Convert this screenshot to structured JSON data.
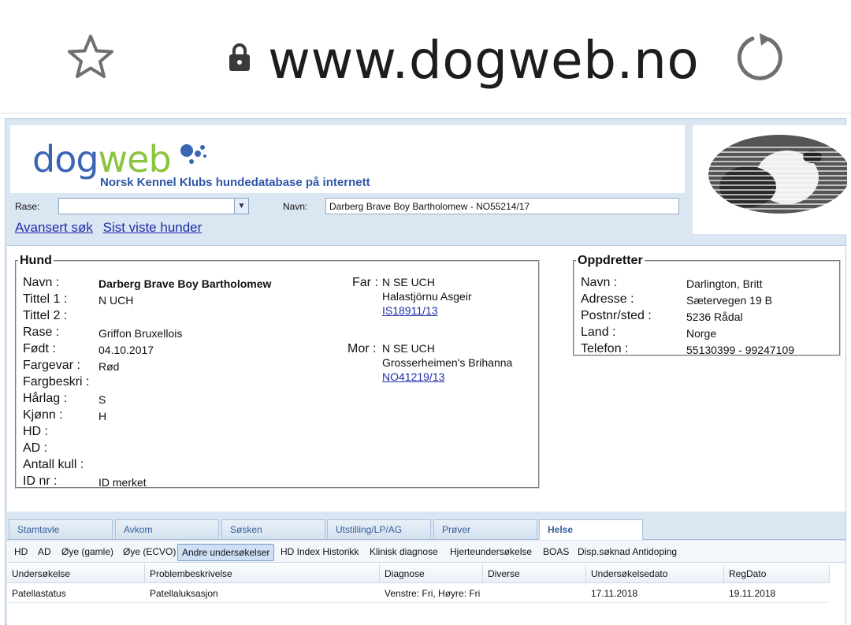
{
  "browser": {
    "url": "www.dogweb.no",
    "star_icon": "star-outline-icon",
    "lock_icon": "lock-icon",
    "reload_icon": "reload-icon"
  },
  "header": {
    "logo_part1": "dog",
    "logo_part2": "web",
    "logo_colors": {
      "dog": "#3a64b4",
      "web": "#8bc53f"
    },
    "subtitle": "Norsk Kennel Klubs hundedatabase på internett"
  },
  "search": {
    "rase_label": "Rase:",
    "rase_value": "",
    "navn_label": "Navn:",
    "navn_value": "Darberg Brave Boy Bartholomew - NO55214/17"
  },
  "links": {
    "advanced": "Avansert søk",
    "recent": "Sist viste hunder"
  },
  "hund": {
    "legend": "Hund",
    "fields": [
      {
        "label": "Navn :",
        "value": "Darberg Brave Boy Bartholomew"
      },
      {
        "label": "Tittel 1 :",
        "value": "N UCH"
      },
      {
        "label": "Tittel 2 :",
        "value": ""
      },
      {
        "label": "Rase :",
        "value": "Griffon Bruxellois"
      },
      {
        "label": "Født :",
        "value": "04.10.2017"
      },
      {
        "label": "Fargevar :",
        "value": "Rød"
      },
      {
        "label": "Fargbeskri :",
        "value": ""
      },
      {
        "label": "Hårlag :",
        "value": "S"
      },
      {
        "label": "Kjønn :",
        "value": "H"
      },
      {
        "label": "HD :",
        "value": ""
      },
      {
        "label": "AD :",
        "value": ""
      },
      {
        "label": "Antall kull :",
        "value": ""
      },
      {
        "label": "ID nr :",
        "value": "ID merket"
      }
    ],
    "far": {
      "label": "Far :",
      "title": "N SE UCH",
      "name": "Halastjörnu Asgeir",
      "reg": "IS18911/13"
    },
    "mor": {
      "label": "Mor :",
      "title": "N SE UCH",
      "name": "Grosserheimen's Brihanna",
      "reg": "NO41219/13"
    }
  },
  "oppdretter": {
    "legend": "Oppdretter",
    "fields": [
      {
        "label": "Navn :",
        "value": "Darlington, Britt"
      },
      {
        "label": "Adresse :",
        "value": "Sætervegen 19 B"
      },
      {
        "label": "Postnr/sted :",
        "value": "5236 Rådal"
      },
      {
        "label": "Land :",
        "value": "Norge"
      },
      {
        "label": "Telefon :",
        "value": "55130399 - 99247109"
      }
    ]
  },
  "tabs": [
    "Stamtavle",
    "Avkom",
    "Søsken",
    "Utstilling/LP/AG",
    "Prøver",
    "Helse"
  ],
  "active_tab": "Helse",
  "subtabs": [
    "HD",
    "AD",
    "Øye (gamle)",
    "Øye (ECVO)",
    "Andre undersøkelser",
    "HD Index Historikk",
    "Klinisk diagnose",
    "Hjerteundersøkelse",
    "BOAS",
    "Disp.søknad Antidoping"
  ],
  "active_subtab": "Andre undersøkelser",
  "table": {
    "columns": [
      "Undersøkelse",
      "Problembeskrivelse",
      "Diagnose",
      "Diverse",
      "Undersøkelsedato",
      "RegDato"
    ],
    "rows": [
      [
        "Patellastatus",
        "Patellaluksasjon",
        "Venstre: Fri, Høyre: Fri",
        "",
        "17.11.2018",
        "19.11.2018"
      ]
    ]
  }
}
